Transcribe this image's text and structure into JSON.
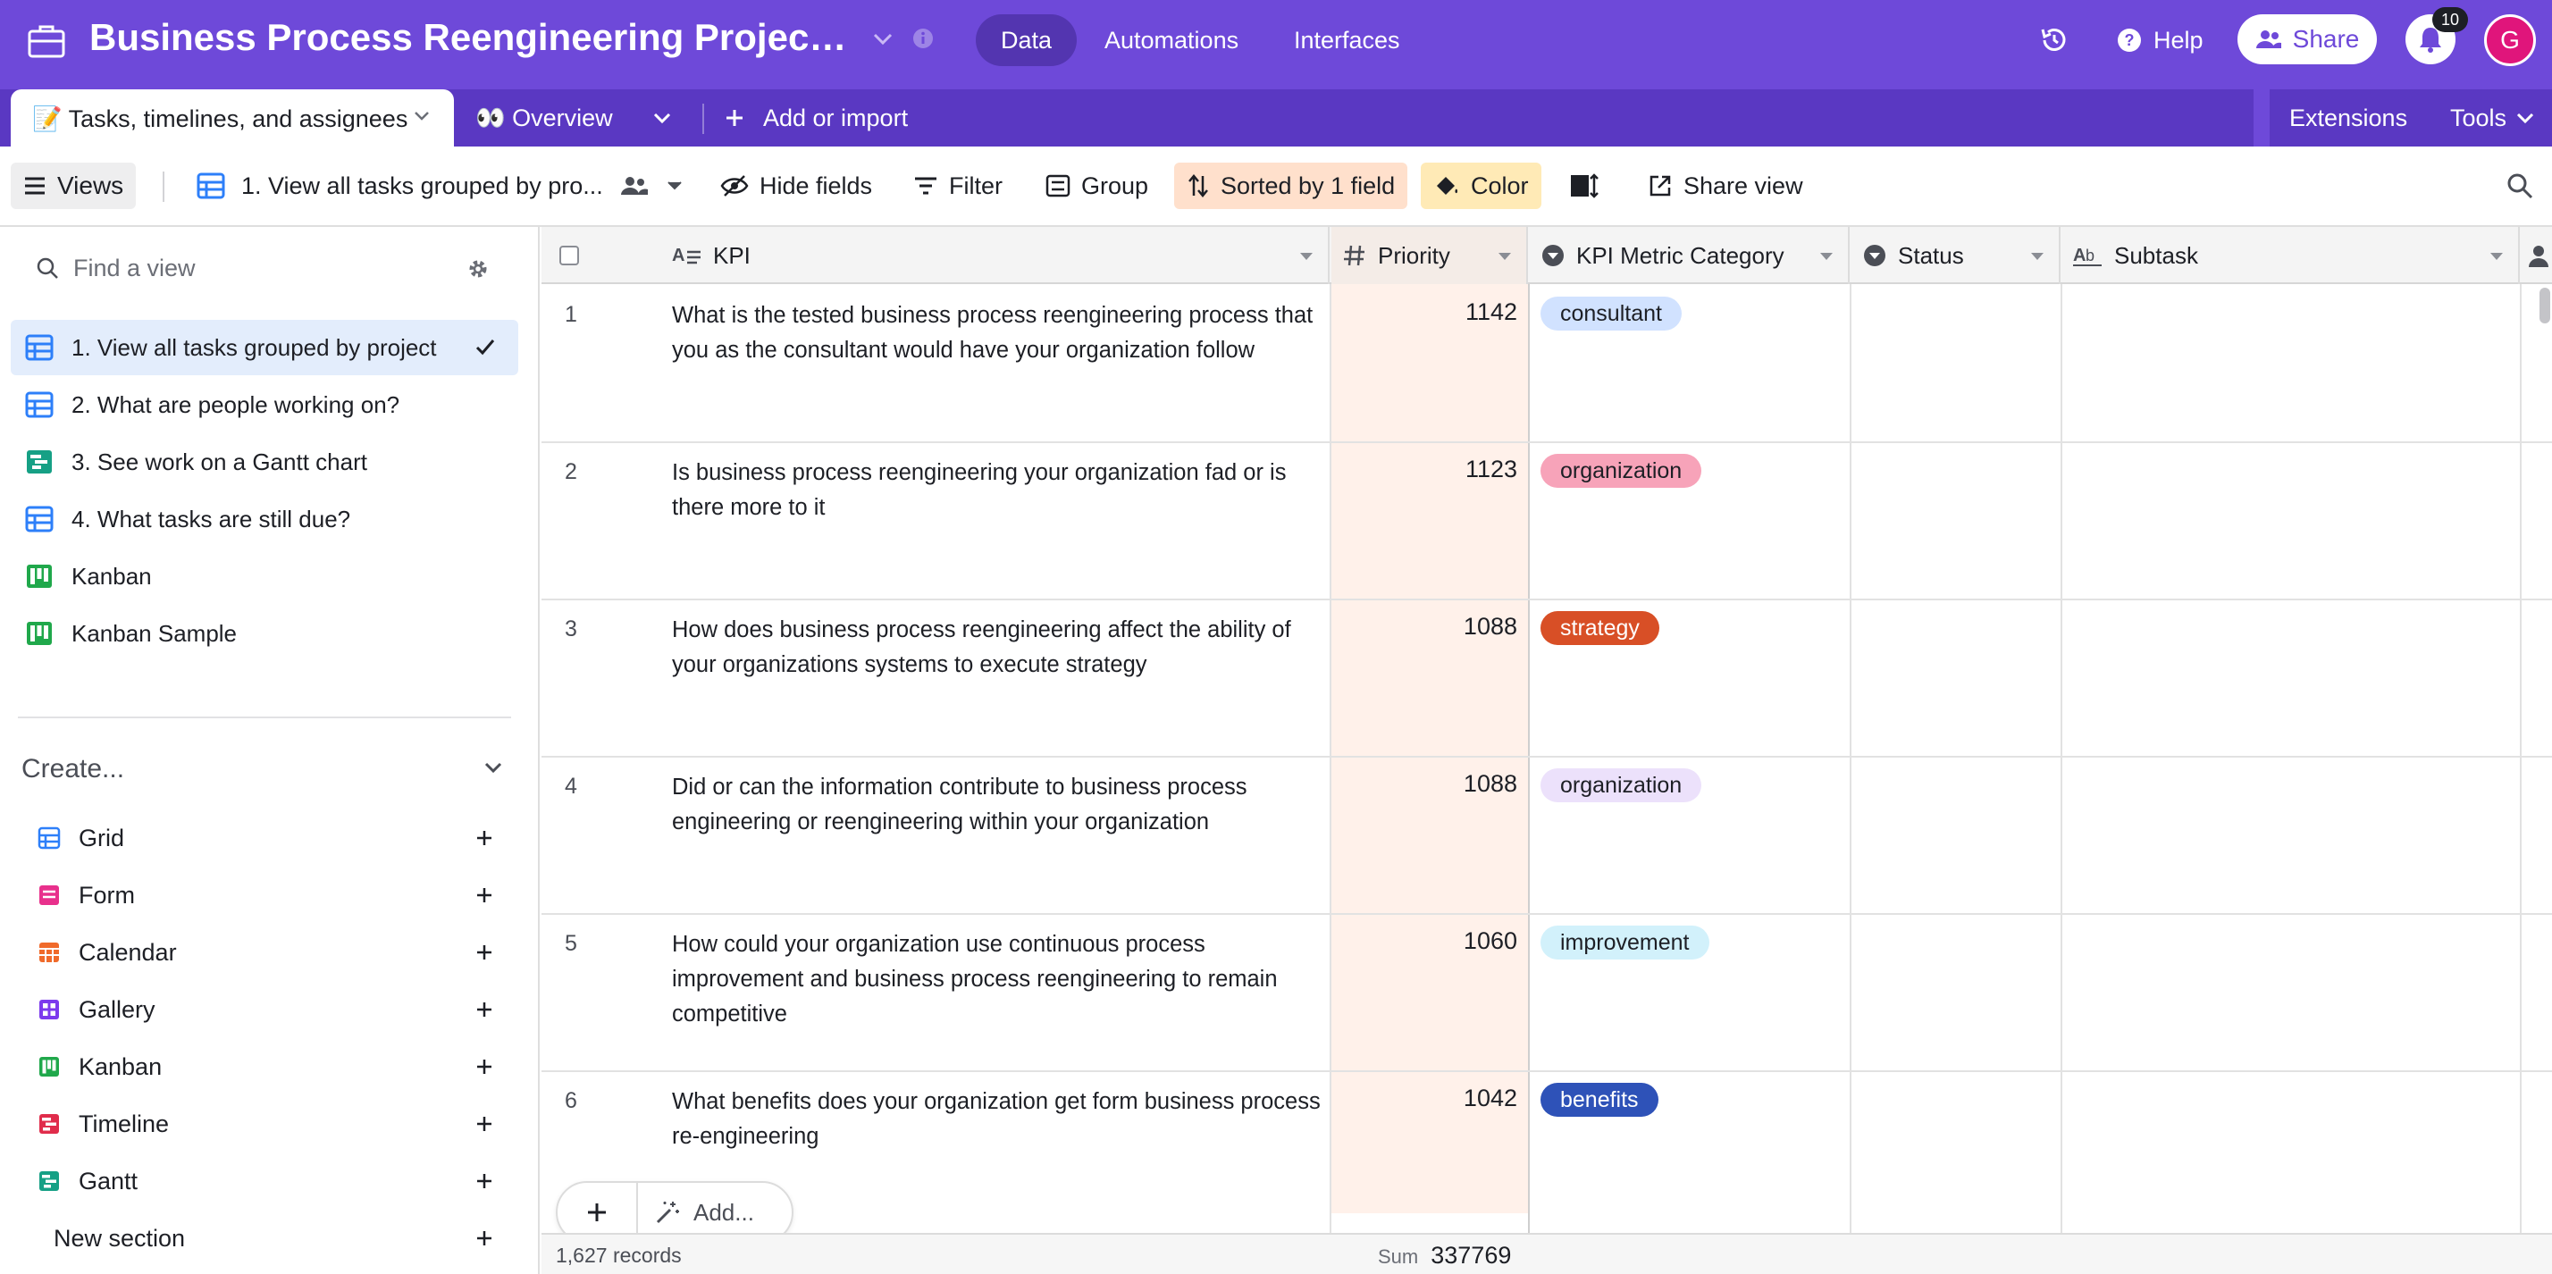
{
  "app": {
    "base_title": "Business Process Reengineering Project Tra...",
    "nav": [
      {
        "label": "Data",
        "active": true
      },
      {
        "label": "Automations",
        "active": false
      },
      {
        "label": "Interfaces",
        "active": false
      }
    ],
    "help_label": "Help",
    "share_label": "Share",
    "notification_count": "10",
    "avatar_initial": "G",
    "accent": "#6e49d9"
  },
  "tables": {
    "active_table": "📝 Tasks, timelines, and assignees",
    "overview_label": "👀 Overview",
    "add_or_import_label": "Add or import",
    "extensions_label": "Extensions",
    "tools_label": "Tools"
  },
  "toolbar": {
    "views_label": "Views",
    "current_view": "1. View all tasks grouped by pro...",
    "hide_fields_label": "Hide fields",
    "filter_label": "Filter",
    "group_label": "Group",
    "sorted_label": "Sorted by 1 field",
    "color_label": "Color",
    "share_view_label": "Share view"
  },
  "sidebar": {
    "find_placeholder": "Find a view",
    "views": [
      {
        "label": "1. View all tasks grouped by project",
        "type": "grid",
        "selected": true
      },
      {
        "label": "2. What are people working on?",
        "type": "grid",
        "selected": false
      },
      {
        "label": "3. See work on a Gantt chart",
        "type": "gantt",
        "selected": false
      },
      {
        "label": "4. What tasks are still due?",
        "type": "grid",
        "selected": false
      },
      {
        "label": "Kanban",
        "type": "kanban",
        "selected": false
      },
      {
        "label": "Kanban Sample",
        "type": "kanban",
        "selected": false
      }
    ],
    "create_label": "Create...",
    "create_items": [
      {
        "label": "Grid",
        "color": "#2d7ff9"
      },
      {
        "label": "Form",
        "color": "#e8308c"
      },
      {
        "label": "Calendar",
        "color": "#f06a2a"
      },
      {
        "label": "Gallery",
        "color": "#7c3aed"
      },
      {
        "label": "Kanban",
        "color": "#20a84b"
      },
      {
        "label": "Timeline",
        "color": "#e02c4b"
      },
      {
        "label": "Gantt",
        "color": "#16a085"
      }
    ],
    "new_section_label": "New section"
  },
  "grid": {
    "columns": {
      "kpi": "KPI",
      "priority": "Priority",
      "category": "KPI Metric Category",
      "status": "Status",
      "subtask": "Subtask"
    },
    "rows": [
      {
        "num": "1",
        "kpi": "What is the tested business process reengineering process that you as the consultant would have your organization follow",
        "priority": "1142",
        "category": "consultant",
        "cat_bg": "#d1e2ff",
        "cat_fg": "#1d1f25"
      },
      {
        "num": "2",
        "kpi": "Is business process reengineering your organization fad or is there more to it",
        "priority": "1123",
        "category": "organization",
        "cat_bg": "#f7a3b9",
        "cat_fg": "#1d1f25"
      },
      {
        "num": "3",
        "kpi": "How does business process reengineering affect the ability of your organizations systems to execute strategy",
        "priority": "1088",
        "category": "strategy",
        "cat_bg": "#d84f26",
        "cat_fg": "#ffffff"
      },
      {
        "num": "4",
        "kpi": "Did or can the information contribute to business process engineering or reengineering within your organization",
        "priority": "1088",
        "category": "organization",
        "cat_bg": "#ece1fb",
        "cat_fg": "#1d1f25"
      },
      {
        "num": "5",
        "kpi": "How could your organization use continuous process improvement and business process reengineering to remain competitive",
        "priority": "1060",
        "category": "improvement",
        "cat_bg": "#d2f1fb",
        "cat_fg": "#1d1f25"
      },
      {
        "num": "6",
        "kpi": "What benefits does your organization get form business process re-engineering",
        "priority": "1042",
        "category": "benefits",
        "cat_bg": "#2e52b8",
        "cat_fg": "#ffffff"
      }
    ],
    "add_label": "Add...",
    "records_label": "1,627 records",
    "sum_label": "Sum",
    "sum_value": "337769"
  }
}
